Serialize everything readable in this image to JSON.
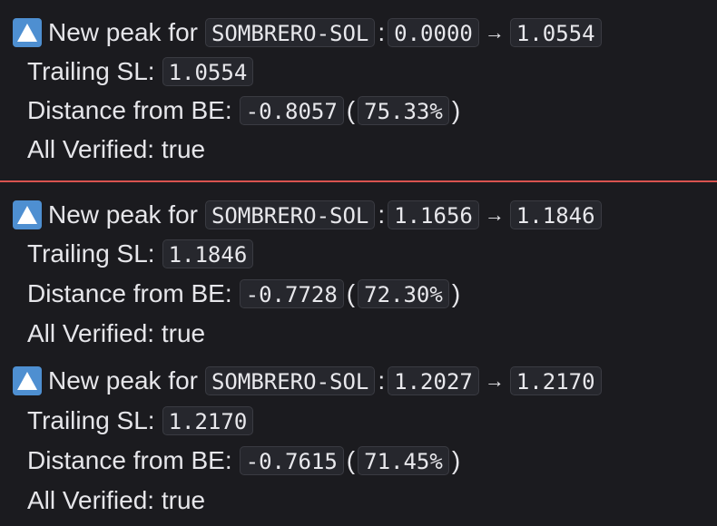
{
  "theme": {
    "background": "#1b1b1f",
    "text": "#e6e6ea",
    "divider": "#d9534f",
    "emoji_bg": "#4e8fd1"
  },
  "messages": [
    {
      "icon": "up-triangle-icon",
      "peak_label": "New peak for",
      "symbol": "SOMBRERO-SOL",
      "colon": ":",
      "from_value": "0.0000",
      "arrow": "→",
      "to_value": "1.0554",
      "trailing_label": "Trailing SL:",
      "trailing_value": "1.0554",
      "distance_label": "Distance from BE:",
      "distance_value": "-0.8057",
      "open_paren": "(",
      "distance_pct": "75.33%",
      "close_paren": ")",
      "verified_text": "All Verified: true"
    },
    {
      "icon": "up-triangle-icon",
      "peak_label": "New peak for",
      "symbol": "SOMBRERO-SOL",
      "colon": ":",
      "from_value": "1.1656",
      "arrow": "→",
      "to_value": "1.1846",
      "trailing_label": "Trailing SL:",
      "trailing_value": "1.1846",
      "distance_label": "Distance from BE:",
      "distance_value": "-0.7728",
      "open_paren": "(",
      "distance_pct": "72.30%",
      "close_paren": ")",
      "verified_text": "All Verified: true"
    },
    {
      "icon": "up-triangle-icon",
      "peak_label": "New peak for",
      "symbol": "SOMBRERO-SOL",
      "colon": ":",
      "from_value": "1.2027",
      "arrow": "→",
      "to_value": "1.2170",
      "trailing_label": "Trailing SL:",
      "trailing_value": "1.2170",
      "distance_label": "Distance from BE:",
      "distance_value": "-0.7615",
      "open_paren": "(",
      "distance_pct": "71.45%",
      "close_paren": ")",
      "verified_text": "All Verified: true"
    }
  ]
}
